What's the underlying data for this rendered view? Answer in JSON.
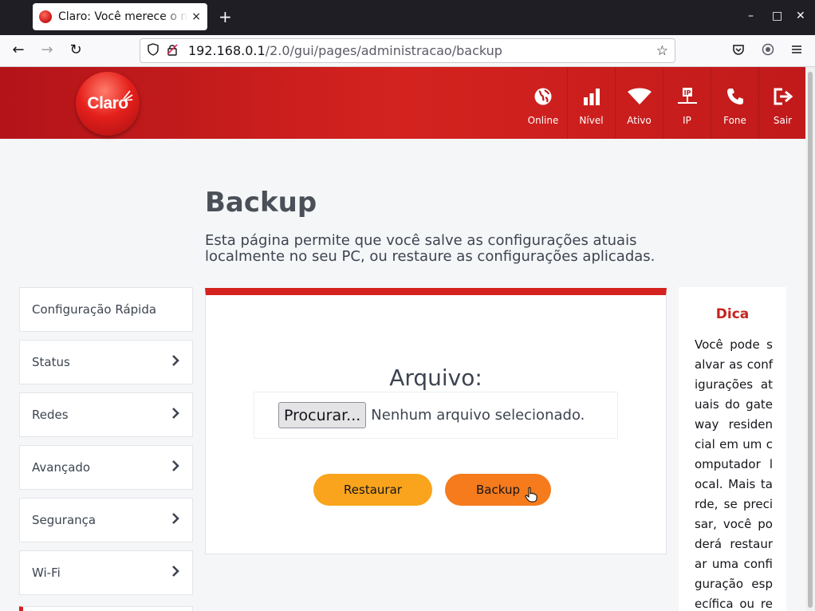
{
  "browser": {
    "tab_title": "Claro: Você merece o nov",
    "tab_close": "×",
    "new_tab": "+",
    "url_host": "192.168.0.1",
    "url_path": "/2.0/gui/pages/administracao/backup",
    "window_controls": {
      "minimize": "–",
      "maximize": "□",
      "close": "✕"
    },
    "nav": {
      "back": "←",
      "forward": "→",
      "reload": "↻"
    }
  },
  "header": {
    "logo": "Claro",
    "nav": [
      {
        "label": "Online",
        "icon": "globe-icon"
      },
      {
        "label": "Nível",
        "icon": "signal-bars-icon"
      },
      {
        "label": "Ativo",
        "icon": "wifi-icon"
      },
      {
        "label": "IP",
        "icon": "ip-network-icon"
      },
      {
        "label": "Fone",
        "icon": "phone-icon"
      },
      {
        "label": "Sair",
        "icon": "logout-icon"
      }
    ]
  },
  "page": {
    "title": "Backup",
    "description": "Esta página permite que você salve as configurações atuais localmente no seu PC, ou restaure as configurações aplicadas."
  },
  "sidebar": {
    "items": [
      {
        "label": "Configuração Rápida",
        "has_chevron": false
      },
      {
        "label": "Status",
        "has_chevron": true
      },
      {
        "label": "Redes",
        "has_chevron": true
      },
      {
        "label": "Avançado",
        "has_chevron": true
      },
      {
        "label": "Segurança",
        "has_chevron": true
      },
      {
        "label": "Wi-Fi",
        "has_chevron": true
      }
    ]
  },
  "form": {
    "file_label": "Arquivo:",
    "browse_button": "Procurar...",
    "file_status": "Nenhum arquivo selecionado.",
    "restore_button": "Restaurar",
    "backup_button": "Backup"
  },
  "tip": {
    "title": "Dica",
    "text": "Você pode salvar as configurações atuais do gateway residencial em um computador local. Mais tarde, se precisar, você poderá restaurar uma configuração específica ou recup"
  },
  "colors": {
    "brand_red": "#d4231f",
    "restore_orange": "#f9a41c",
    "backup_orange": "#f57b1c",
    "tip_title_red": "#c8231f"
  }
}
